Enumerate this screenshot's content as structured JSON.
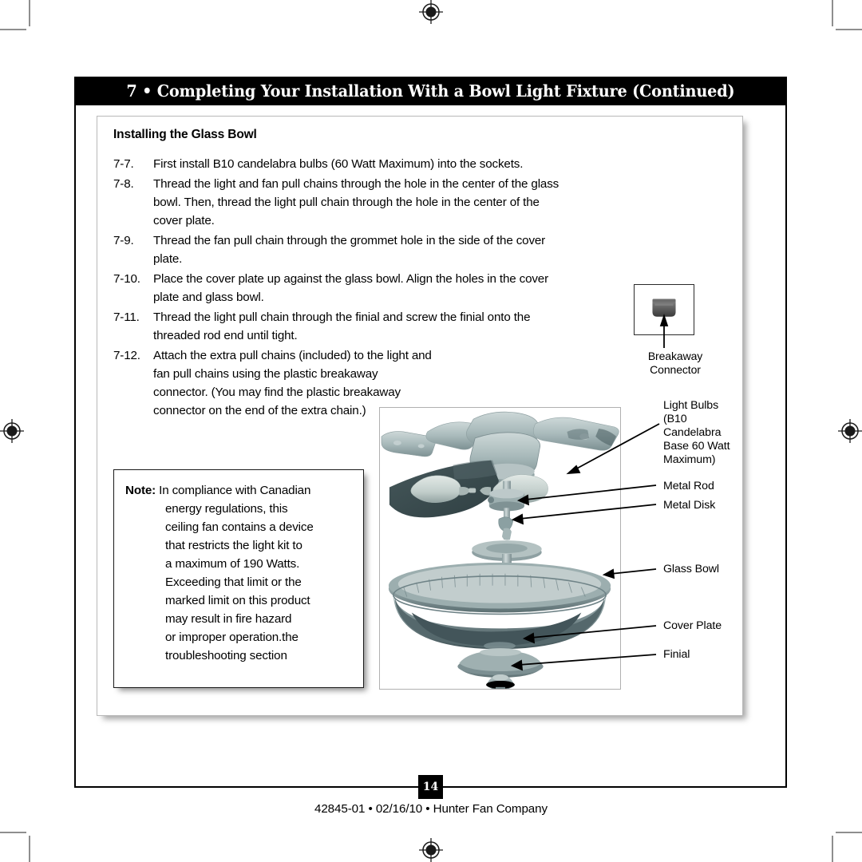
{
  "header": {
    "title": "7 • Completing Your Installation With a Bowl Light Fixture (Continued)"
  },
  "content": {
    "section_heading": "Installing the Glass Bowl",
    "steps": [
      {
        "number": "7-7.",
        "text": "First install B10 candelabra bulbs (60 Watt Maximum) into the sockets."
      },
      {
        "number": "7-8.",
        "text": "Thread the light and fan pull chains through the hole in the center of the glass bowl. Then, thread the light pull chain through the hole in the center of the cover plate."
      },
      {
        "number": "7-9.",
        "text": "Thread the fan pull chain through the grommet hole in the side of the cover plate."
      },
      {
        "number": "7-10.",
        "text": "Place the cover plate up against the glass bowl. Align the holes in the cover plate and glass bowl."
      },
      {
        "number": "7-11.",
        "text": "Thread the light pull chain through the finial and screw the finial onto the threaded rod end until tight."
      },
      {
        "number": "7-12.",
        "text": "Attach the extra pull chains (included) to the light and fan pull chains using the plastic breakaway connector. (You may find the plastic breakaway connector on the end of the extra chain.)"
      }
    ]
  },
  "note": {
    "label": "Note:",
    "first_line": "In compliance with Canadian",
    "lines": [
      "energy regulations, this",
      "ceiling fan contains a device",
      "that restricts the light kit to",
      "a maximum of 190 Watts.",
      "Exceeding that limit or the",
      "marked limit on this product",
      "may result in fire hazard",
      "or improper operation.the",
      "troubleshooting section"
    ]
  },
  "breakaway": {
    "caption": "Breakaway\nConnector"
  },
  "callouts": {
    "light_bulbs": "Light Bulbs\n(B10\nCandelabra\nBase 60 Watt\nMaximum)",
    "metal_rod": "Metal Rod",
    "metal_disk": "Metal Disk",
    "glass_bowl": "Glass Bowl",
    "cover_plate": "Cover Plate",
    "finial": "Finial"
  },
  "footer": {
    "page_number": "14",
    "imprint": "42845-01  •  02/16/10  •  Hunter Fan Company"
  },
  "colors": {
    "title_bar": "#000000",
    "metal_light": "#b9c6c7",
    "metal_mid": "#8b9d9f",
    "metal_dark": "#3d4f52",
    "bulb": "#ccd6d4",
    "leader_line": "#000000"
  }
}
